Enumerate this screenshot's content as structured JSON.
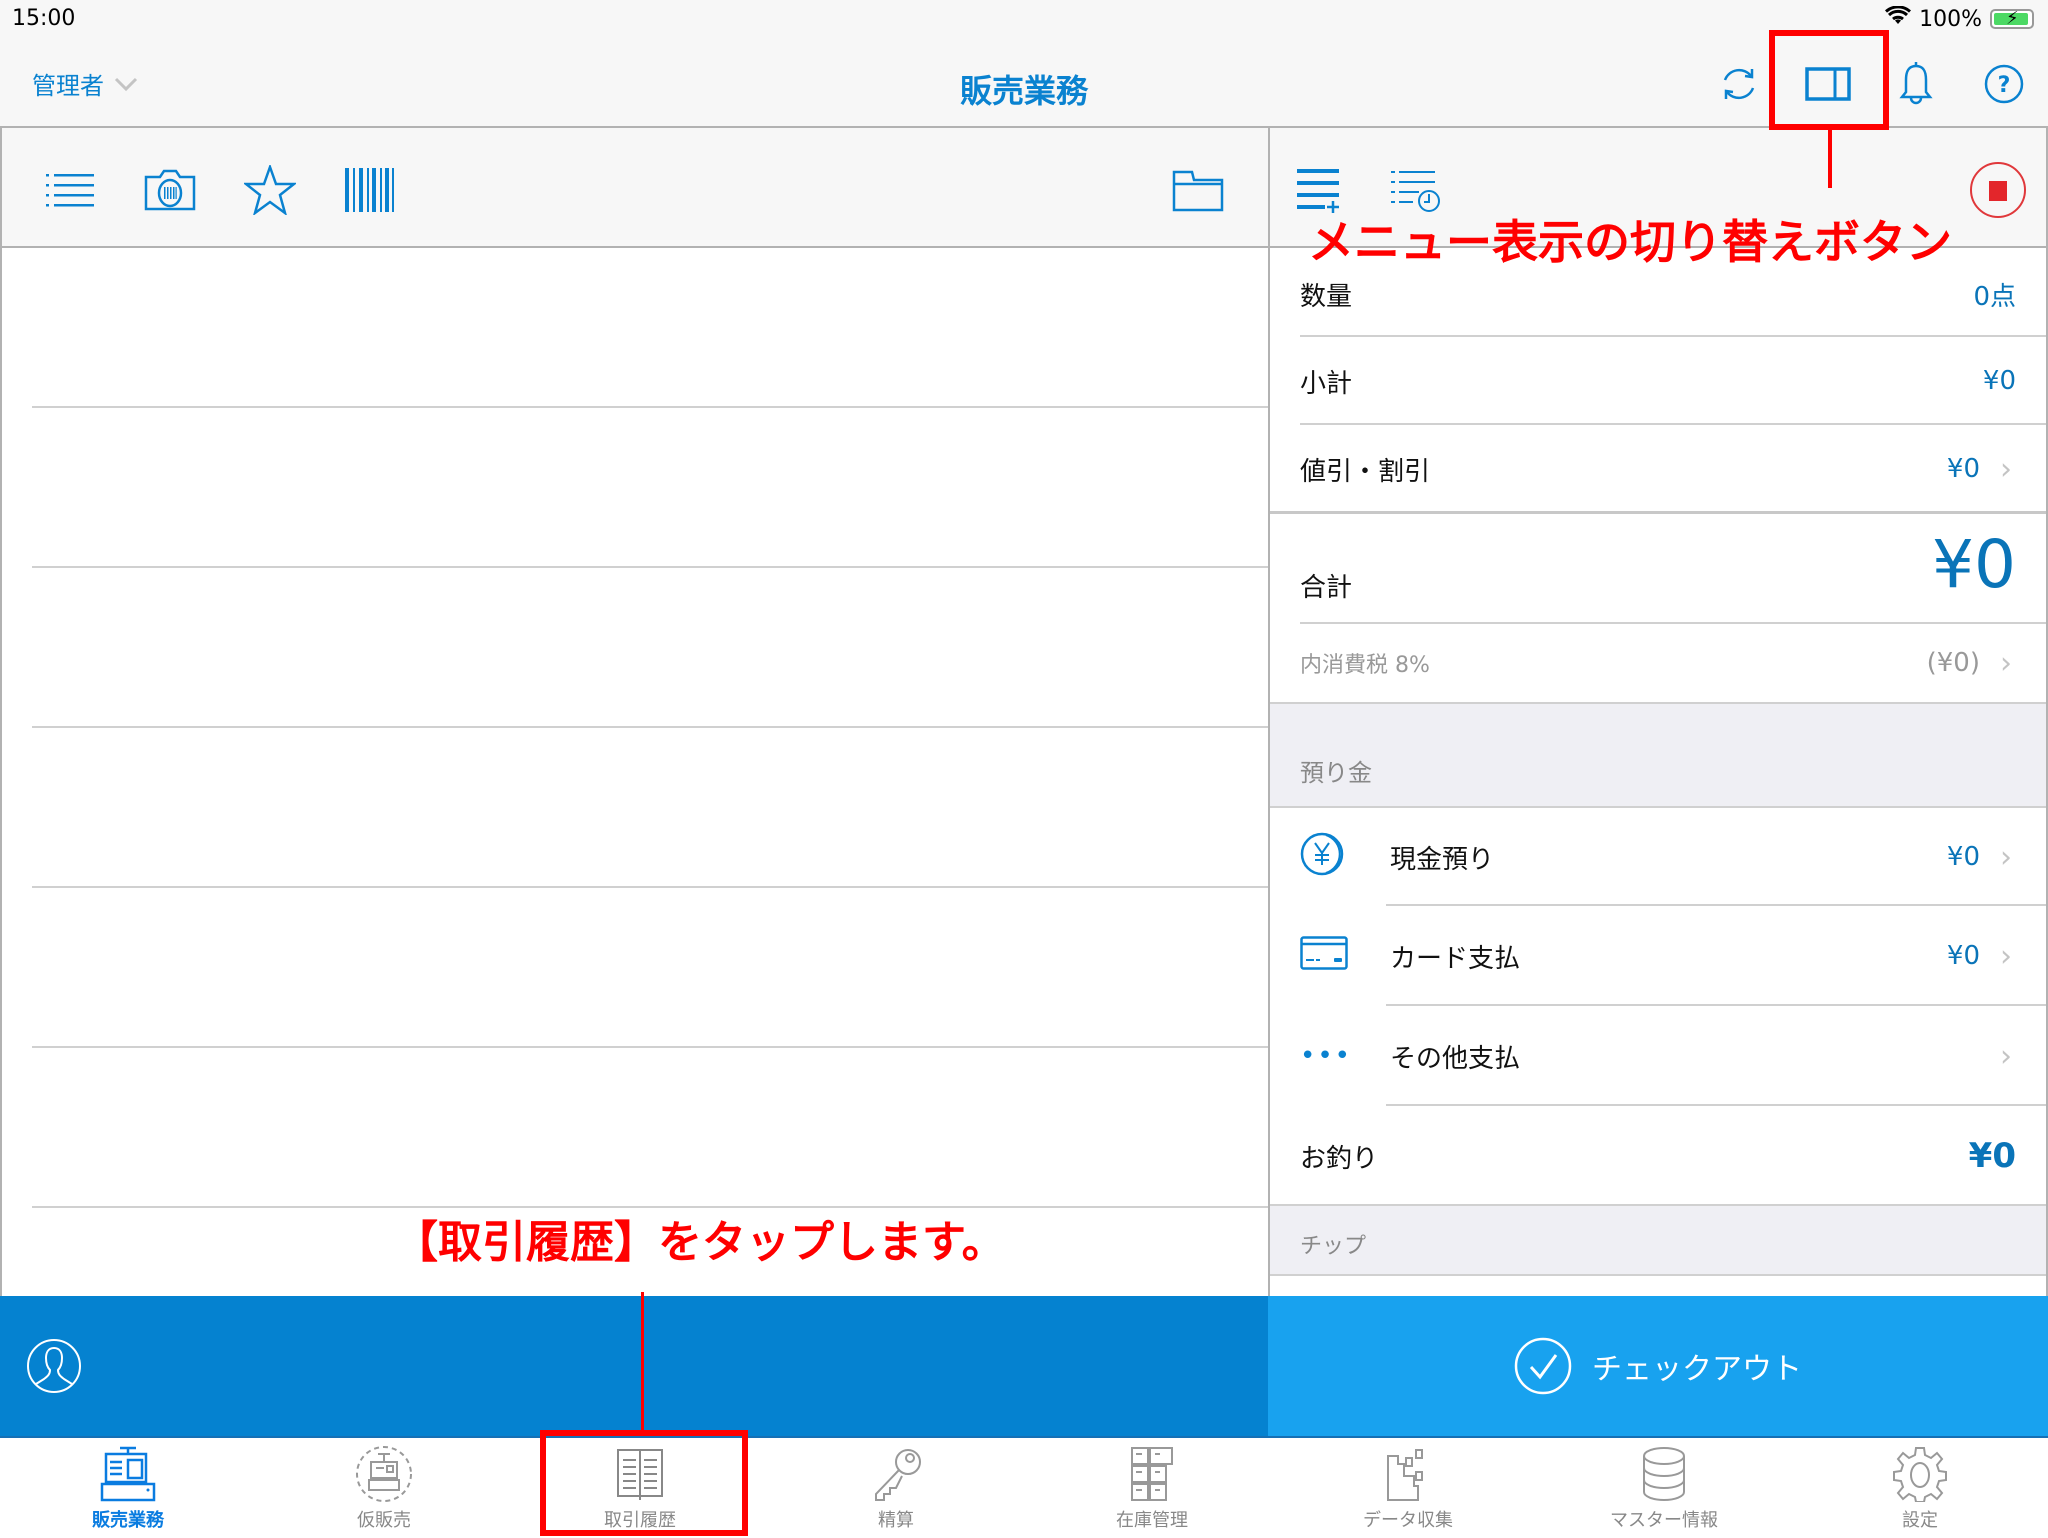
{
  "status_bar": {
    "time": "15:00",
    "battery": "100%"
  },
  "nav": {
    "user_label": "管理者",
    "title": "販売業務",
    "icons": [
      "sync-icon",
      "split-view-toggle-icon",
      "bell-icon",
      "help-icon"
    ]
  },
  "left_toolbar": {
    "icons": [
      "list-icon",
      "barcode-camera-icon",
      "star-icon",
      "barcode-icon",
      "folder-icon"
    ]
  },
  "right_toolbar": {
    "icons": [
      "add-list-icon",
      "list-history-icon",
      "stop-record-icon"
    ]
  },
  "summary": {
    "quantity": {
      "label": "数量",
      "value": "0点"
    },
    "subtotal": {
      "label": "小計",
      "value": "¥0"
    },
    "discount": {
      "label": "値引・割引",
      "value": "¥0"
    },
    "total": {
      "label": "合計",
      "value": "¥0"
    },
    "tax": {
      "label": "内消費税 8%",
      "value": "(¥0)"
    }
  },
  "deposit": {
    "section_label": "預り金",
    "items": [
      {
        "label": "現金預り",
        "value": "¥0",
        "icon": "yen-coin-icon"
      },
      {
        "label": "カード支払",
        "value": "¥0",
        "icon": "credit-card-icon"
      },
      {
        "label": "その他支払",
        "value": "",
        "icon": "more-icon"
      }
    ]
  },
  "change": {
    "label": "お釣り",
    "value": "¥0"
  },
  "tip": {
    "section_label": "チップ"
  },
  "checkout": {
    "label": "チェックアウト"
  },
  "tabs": [
    {
      "label": "販売業務",
      "active": true
    },
    {
      "label": "仮販売",
      "active": false
    },
    {
      "label": "取引履歴",
      "active": false
    },
    {
      "label": "精算",
      "active": false
    },
    {
      "label": "在庫管理",
      "active": false
    },
    {
      "label": "データ収集",
      "active": false
    },
    {
      "label": "マスター情報",
      "active": false
    },
    {
      "label": "設定",
      "active": false
    }
  ],
  "annotations": {
    "menu_toggle": "メニュー表示の切り替えボタン",
    "tap_history": "【取引履歴】をタップします。"
  },
  "colors": {
    "accent": "#0a82d0",
    "checkout": "#18a2ef",
    "customer_bar": "#0582d0",
    "annotation": "#ff0000"
  }
}
